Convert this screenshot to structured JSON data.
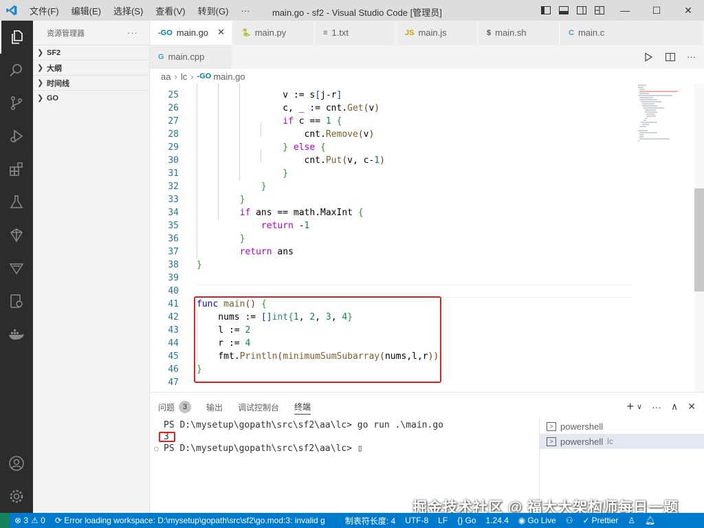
{
  "window": {
    "title": "main.go - sf2 - Visual Studio Code [管理员]",
    "menu": [
      "文件(F)",
      "编辑(E)",
      "选择(S)",
      "查看(V)",
      "转到(G)",
      "···"
    ]
  },
  "sidebar": {
    "title": "资源管理器",
    "more": "···",
    "sections": [
      "SF2",
      "大纲",
      "时间线",
      "GO"
    ]
  },
  "tabs": {
    "row1": [
      {
        "icon": "-GO",
        "label": "main.go",
        "close": "✕"
      },
      {
        "icon": "🐍",
        "label": "main.py"
      },
      {
        "icon": "≡",
        "label": "1.txt"
      },
      {
        "icon": "JS",
        "label": "main.js"
      },
      {
        "icon": "$",
        "label": "main.sh"
      },
      {
        "icon": "C",
        "label": "main.c"
      }
    ],
    "row2": [
      {
        "icon": "G",
        "label": "main.cpp"
      }
    ]
  },
  "breadcrumb": {
    "parts": [
      "aa",
      "lc"
    ],
    "icon": "-GO",
    "file": "main.go"
  },
  "editor": {
    "line_numbers": [
      "25",
      "26",
      "27",
      "28",
      "29",
      "30",
      "31",
      "32",
      "33",
      "34",
      "35",
      "36",
      "37",
      "38",
      "39",
      "40",
      "41",
      "42",
      "43",
      "44",
      "45",
      "46",
      "47"
    ],
    "lines": [
      "                v := s[j-r]",
      "                c, _ := cnt.Get(v)",
      "                if c == 1 {",
      "                    cnt.Remove(v)",
      "                } else {",
      "                    cnt.Put(v, c-1)",
      "                }",
      "            }",
      "        }",
      "        if ans == math.MaxInt {",
      "            return -1",
      "        }",
      "        return ans",
      "}",
      "",
      "",
      "func main() {",
      "    nums := []int{1, 2, 3, 4}",
      "    l := 2",
      "    r := 4",
      "    fmt.Println(minimumSumSubarray(nums,l,r))",
      "}",
      ""
    ]
  },
  "panel": {
    "tabs": [
      {
        "label": "问题",
        "badge": "3"
      },
      {
        "label": "输出"
      },
      {
        "label": "调试控制台"
      },
      {
        "label": "终端"
      }
    ],
    "actions": [
      "+",
      "∨",
      "···",
      "∧",
      "✕"
    ],
    "terminal": {
      "line1": "PS D:\\mysetup\\gopath\\src\\sf2\\aa\\lc> go run .\\main.go",
      "result": "3",
      "prompt_marker": "○",
      "line3": "PS D:\\mysetup\\gopath\\src\\sf2\\aa\\lc> ",
      "cursor": "▯"
    },
    "terminals": [
      {
        "label": "powershell",
        "sub": ""
      },
      {
        "label": "powershell",
        "sub": "lc"
      }
    ]
  },
  "watermark": "掘金技术社区 @ 福大大架构师每日一题",
  "statusbar": {
    "errors": "⊗ 3",
    "warnings": "⚠ 0",
    "message": "⟳ Error loading workspace: D:\\mysetup\\gopath\\src\\sf2\\go.mod:3: invalid g",
    "indent": "制表符长度: 4",
    "encoding": "UTF-8",
    "eol": "LF",
    "language": "{} Go",
    "version": "1.24.4",
    "golive": "Go Live",
    "prettier": "Prettier"
  }
}
